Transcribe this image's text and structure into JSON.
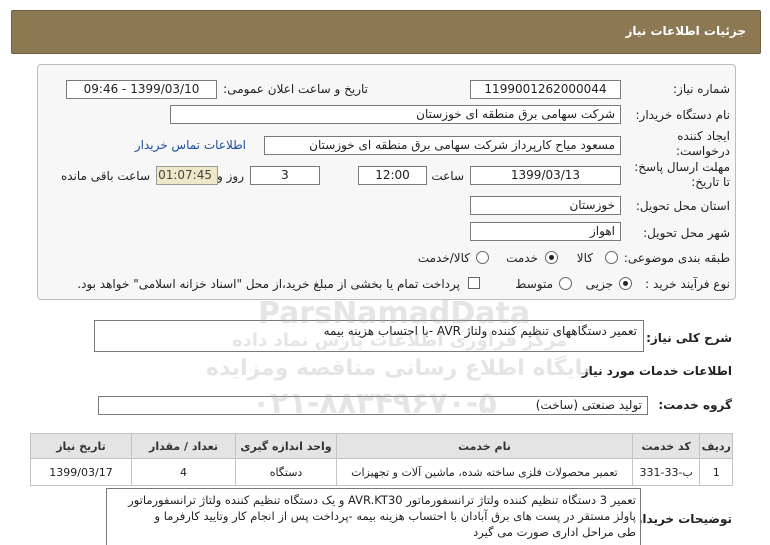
{
  "header": {
    "title": "جزئیات اطلاعات نیاز"
  },
  "form": {
    "need_number_label": "شماره نیاز:",
    "need_number": "1199001262000044",
    "announce_label": "تاریخ و ساعت اعلان عمومی:",
    "announce_value": "1399/03/10 - 09:46",
    "buyer_label": "نام دستگاه خریدار:",
    "buyer_value": "شرکت سهامی برق منطقه ای خوزستان",
    "creator_label_1": "ایجاد کننده",
    "creator_label_2": "درخواست:",
    "creator_value": "مسعود میاح کارپرداز شرکت سهامی برق منطقه ای خوزستان",
    "contact_link": "اطلاعات تماس خریدار",
    "deadline_label_1": "مهلت ارسال پاسخ:",
    "deadline_label_2": "تا تاریخ:",
    "deadline_date": "1399/03/13",
    "time_label": "ساعت",
    "deadline_time": "12:00",
    "days_value": "3",
    "days_label": "روز و",
    "remaining_timer": "01:07:45",
    "remaining_label": "ساعت باقی مانده",
    "province_label": "استان محل تحویل:",
    "province_value": "خوزستان",
    "city_label": "شهر محل تحویل:",
    "city_value": "اهواز",
    "category_label": "طبقه بندی موضوعی:",
    "category_options": [
      "کالا",
      "خدمت",
      "کالا/خدمت"
    ],
    "category_selected": "خدمت",
    "process_label": "نوع فرآیند خرید :",
    "process_options": [
      "جزیی",
      "متوسط"
    ],
    "process_selected": "جزیی",
    "payment_note": "پرداخت تمام یا بخشی از مبلغ خرید،از محل \"اسناد خزانه اسلامی\" خواهد بود."
  },
  "summary": {
    "label": "شرح کلی نیاز:",
    "value": "تعمیر دستگاههای تنظیم کننده ولتاژ AVR -با احتساب هزینه بیمه"
  },
  "services": {
    "section_title": "اطلاعات خدمات مورد نیاز",
    "group_label": "گروه خدمت:",
    "group_value": "تولید صنعتی (ساخت)"
  },
  "table": {
    "headers": [
      "ردیف",
      "کد خدمت",
      "نام خدمت",
      "واحد اندازه گیری",
      "تعداد / مقدار",
      "تاریخ نیاز"
    ],
    "rows": [
      [
        "1",
        "ب-33-331",
        "تعمیر محصولات فلزی ساخته شده، ماشین آلات و تجهیزات",
        "دستگاه",
        "4",
        "1399/03/17"
      ]
    ]
  },
  "buyer_notes": {
    "label": "توضیحات خریدار:",
    "lines": [
      "تعمیر 3 دستگاه تنظیم کننده ولتاژ ترانسفورماتور AVR.KT30 و یک دستگاه تنظیم کننده ولتاژ ترانسفورماتور",
      "پاولز مستقر در پست های برق آبادان با احتساب هزینه بیمه -پرداخت پس از انجام کار وتایید کارفرما و",
      "طی مراحل اداری صورت می گیرد"
    ]
  },
  "watermark": {
    "line1": "ParsNamadData",
    "line2": "مرکز فراوری اطلاعات پارس نماد داده",
    "line3": "پایگاه اطلاع رسانی مناقصه ومزایده",
    "line4": "۰۲۱-۸۸۳۴۹۶۷۰-۵"
  }
}
